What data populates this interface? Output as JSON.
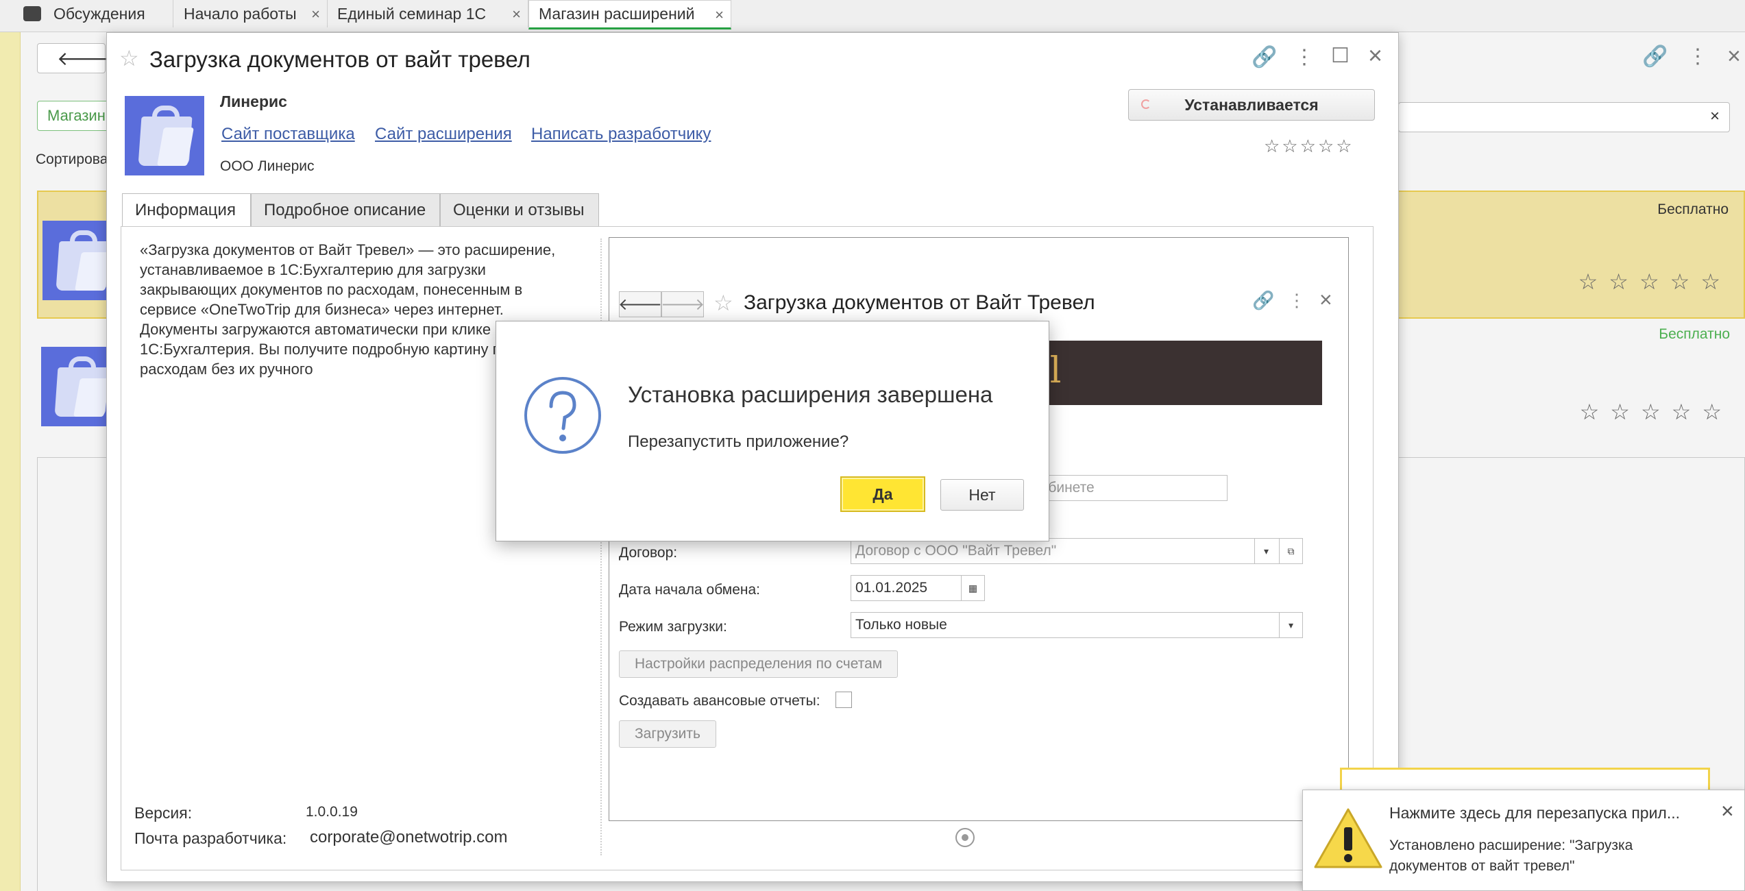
{
  "top_tabs": [
    {
      "label": "Обсуждения"
    },
    {
      "label": "Начало работы"
    },
    {
      "label": "Единый семинар 1С"
    },
    {
      "label": "Магазин расширений"
    }
  ],
  "background": {
    "tag": "Магазин",
    "sort_label": "Сортирова",
    "cards": [
      {
        "price": "Бесплатно",
        "price_color": "#333333"
      },
      {
        "price": "Бесплатно",
        "price_color": "#4caf50"
      }
    ]
  },
  "extension": {
    "title": "Загрузка документов от вайт тревел",
    "vendor": "Линерис",
    "links": [
      "Сайт поставщика",
      "Сайт расширения",
      "Написать разработчику"
    ],
    "company": "ООО Линерис",
    "status_button": "Устанавливается",
    "rating_stars": "☆☆☆☆☆",
    "tabs": [
      "Информация",
      "Подробное описание",
      "Оценки и отзывы"
    ],
    "description": "«Загрузка документов от Вайт Тревел» — это расширение, устанавливаемое в 1С:Бухгалтерию для загрузки закрывающих документов по расходам, понесенным в сервисе «OneTwoTrip для бизнеса» через интернет. Документы загружаются автоматически при клике на кнопку в 1С:Бухгалтерия. Вы получите подробную картину по расходам без их ручного",
    "version_label": "Версия:",
    "version_value": "1.0.0.19",
    "email_label": "Почта разработчика:",
    "email_value": "corporate@onetwotrip.com"
  },
  "screenshot": {
    "title": "Загрузка документов от Вайт Тревел",
    "logo_fragment": "el",
    "partial_field": "кабинете",
    "contract_label": "Договор:",
    "contract_value": "Договор с ООО \"Вайт Тревел\"",
    "date_label": "Дата начала обмена:",
    "date_value": "01.01.2025",
    "mode_label": "Режим загрузки:",
    "mode_value": "Только новые",
    "settings_button": "Настройки распределения по счетам",
    "advance_label": "Создавать авансовые отчеты:",
    "load_button": "Загрузить"
  },
  "dialog": {
    "title": "Установка расширения завершена",
    "question": "Перезапустить приложение?",
    "yes": "Да",
    "no": "Нет"
  },
  "notification": {
    "title": "Нажмите здесь для перезапуска прил...",
    "text": "Установлено расширение: \"Загрузка документов от вайт тревел\""
  }
}
